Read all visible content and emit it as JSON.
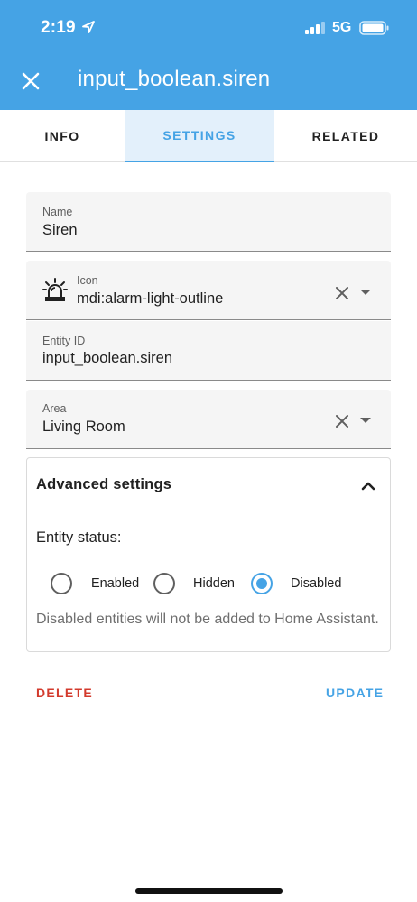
{
  "status_bar": {
    "time": "2:19",
    "network": "5G"
  },
  "app_bar": {
    "title": "input_boolean.siren"
  },
  "tabs": [
    {
      "label": "INFO"
    },
    {
      "label": "SETTINGS",
      "active": true
    },
    {
      "label": "RELATED"
    }
  ],
  "fields": {
    "name": {
      "label": "Name",
      "value": "Siren"
    },
    "icon": {
      "label": "Icon",
      "value": "mdi:alarm-light-outline",
      "icon": "alarm-light-outline-icon"
    },
    "entity_id": {
      "label": "Entity ID",
      "value": "input_boolean.siren"
    },
    "area": {
      "label": "Area",
      "value": "Living Room"
    }
  },
  "advanced": {
    "title": "Advanced settings",
    "expanded": true,
    "status_label": "Entity status:",
    "options": [
      {
        "label": "Enabled",
        "checked": false
      },
      {
        "label": "Hidden",
        "checked": false
      },
      {
        "label": "Disabled",
        "checked": true
      }
    ],
    "help": "Disabled entities will not be added to Home Assistant."
  },
  "actions": {
    "delete": "DELETE",
    "update": "UPDATE"
  },
  "colors": {
    "primary": "#45a3e5",
    "danger": "#d33a2c",
    "tab_active_bg": "#e3f0fb"
  }
}
